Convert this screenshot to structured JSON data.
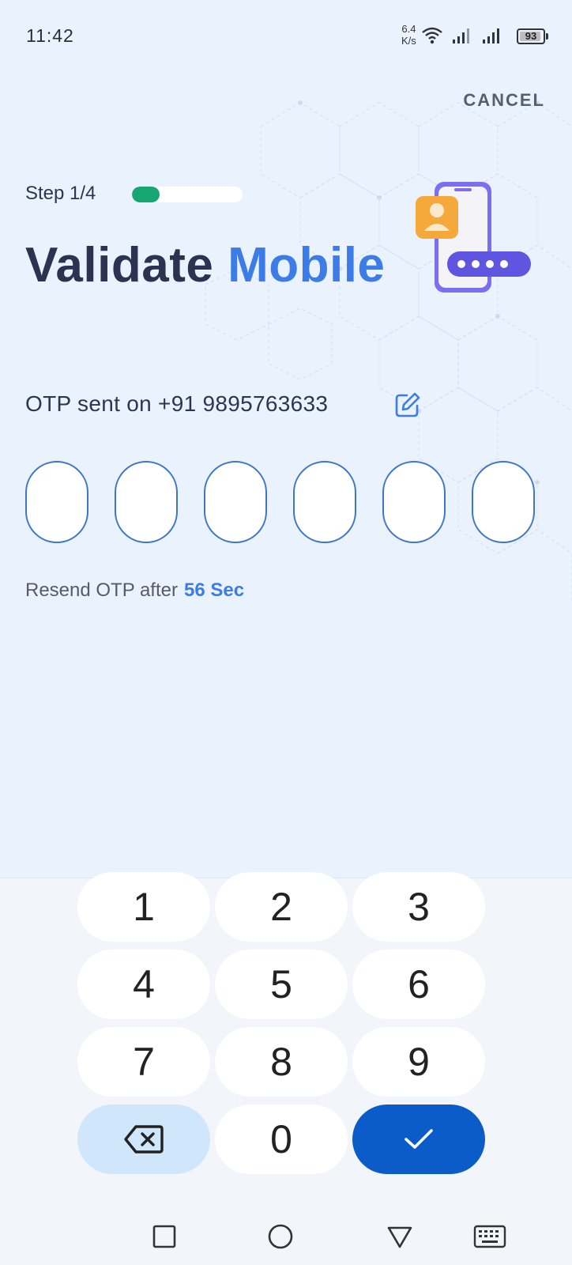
{
  "status_bar": {
    "time": "11:42",
    "net_speed_value": "6.4",
    "net_speed_unit": "K/s",
    "battery": "93",
    "battery_level_pct": 93
  },
  "header": {
    "cancel_label": "CANCEL",
    "step_label": "Step 1/4",
    "progress_fraction": 0.25,
    "title_main": "Validate",
    "title_accent": "Mobile"
  },
  "otp": {
    "sent_text": "OTP sent on +91 9895763633",
    "digits": [
      "",
      "",
      "",
      "",
      "",
      ""
    ],
    "resend_text": "Resend OTP after",
    "resend_countdown": "56 Sec"
  },
  "keypad": {
    "keys": [
      "1",
      "2",
      "3",
      "4",
      "5",
      "6",
      "7",
      "8",
      "9",
      "0"
    ],
    "backspace_icon": "backspace-icon",
    "confirm_icon": "check-icon"
  },
  "nav": {
    "icons": [
      "square-recents-icon",
      "circle-home-icon",
      "triangle-back-icon",
      "keyboard-icon"
    ]
  },
  "colors": {
    "background": "#eaf2fe",
    "accent_blue": "#3b7ce6",
    "progress_green": "#17a673",
    "confirm_blue": "#0b5bc8",
    "backspace_bg": "#cfe6fb",
    "title_dark": "#2b3350"
  }
}
